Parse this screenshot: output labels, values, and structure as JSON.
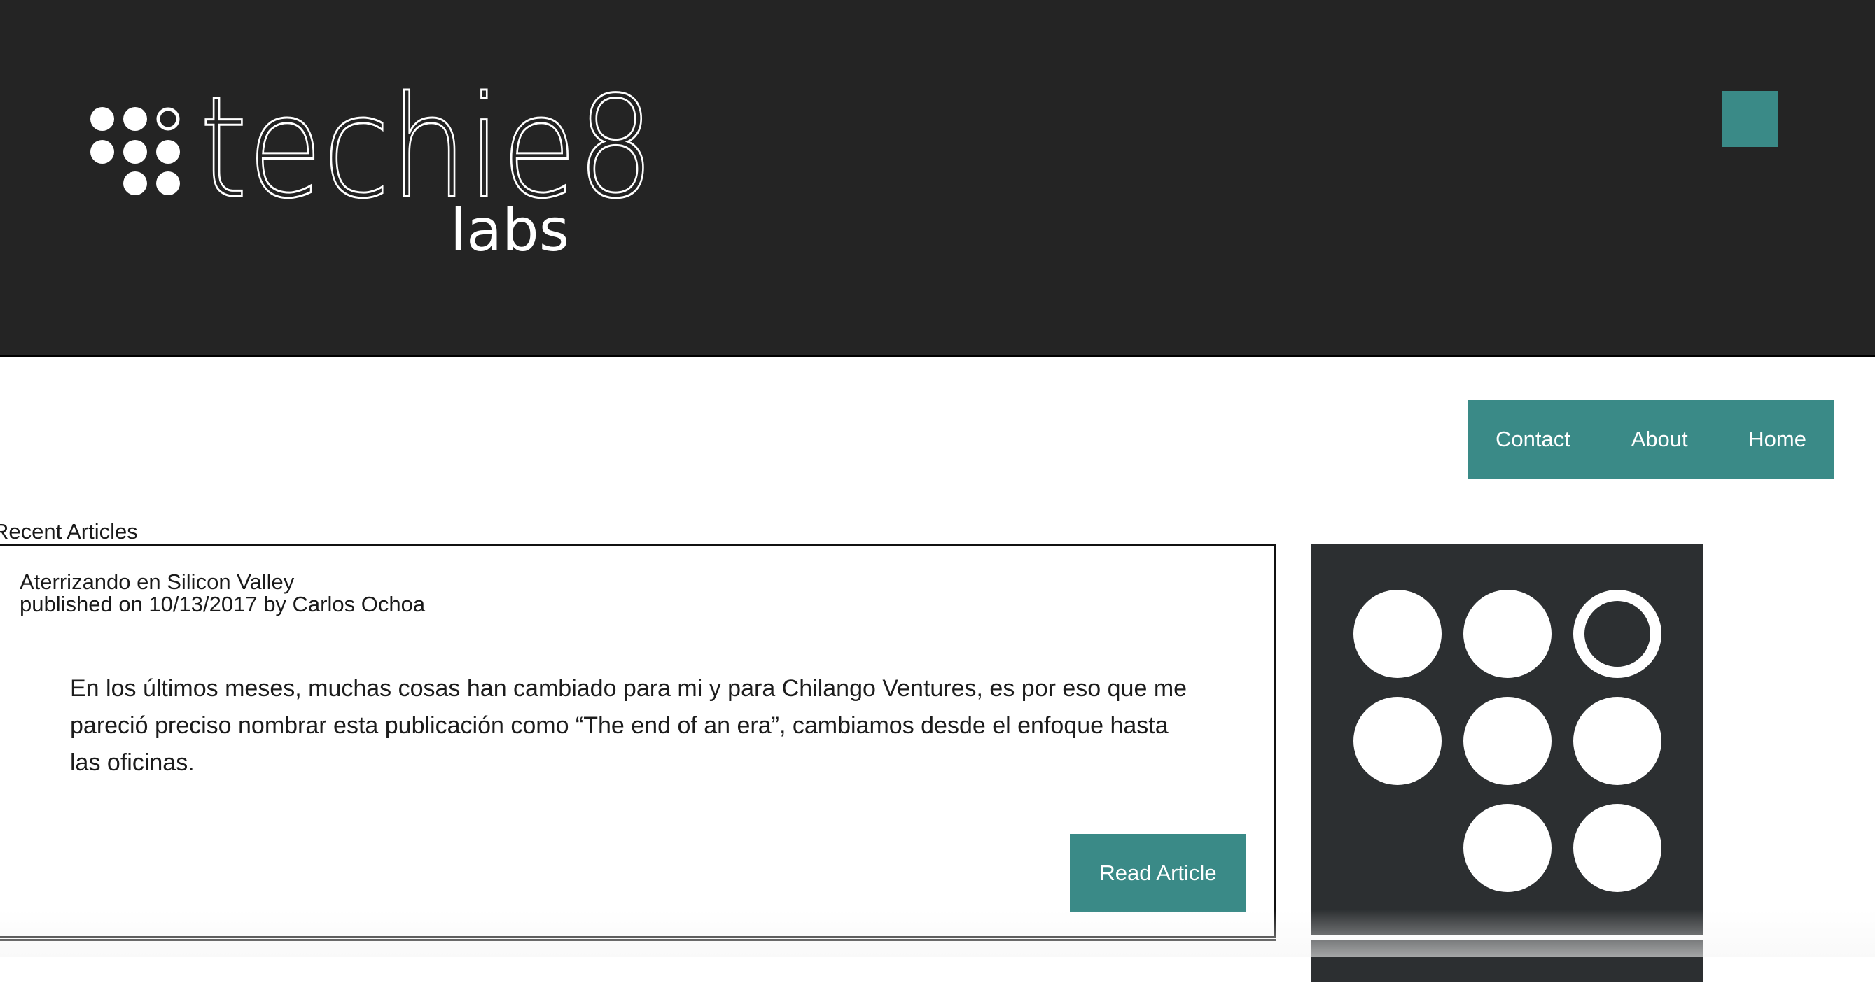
{
  "header": {
    "logo": {
      "wordmark": "techie8",
      "sublabel": "labs",
      "icon": "dots-grid-logo-icon"
    },
    "menu_button_icon": "square-menu-icon",
    "accent_color": "#3a8a87",
    "background_color": "#242424"
  },
  "nav": {
    "items": [
      {
        "label": "Contact"
      },
      {
        "label": "About"
      },
      {
        "label": "Home"
      }
    ]
  },
  "main": {
    "section_title": "Recent Articles",
    "articles": [
      {
        "title": "Aterrizando en Silicon Valley",
        "meta": "published on 10/13/2017 by Carlos Ochoa",
        "excerpt": "En los últimos meses, muchas cosas han cambiado para mi y para Chilango Ventures, es por eso que me pareció preciso nombrar esta publicación como “The end of an era”, cambiamos desde el enfoque hasta las oficinas.",
        "button_label": "Read Article"
      }
    ]
  },
  "sidebar": {
    "image_icon": "dots-grid-logo-icon",
    "background_color": "#2c2f31"
  }
}
